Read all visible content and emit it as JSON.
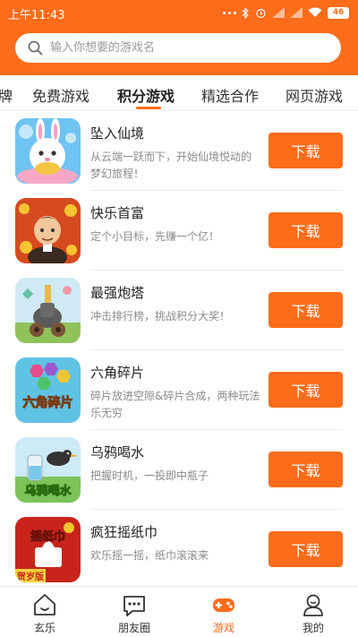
{
  "status_bar": {
    "time": "上午11:43",
    "battery": "46"
  },
  "search": {
    "placeholder": "输入你想要的游戏名"
  },
  "tabs": [
    {
      "label": "牌"
    },
    {
      "label": "免费游戏"
    },
    {
      "label": "积分游戏",
      "active": true
    },
    {
      "label": "精选合作"
    },
    {
      "label": "网页游戏"
    }
  ],
  "games": [
    {
      "title": "坠入仙境",
      "desc": "从云端一跃而下，开始仙境悦动的梦幻旅程！",
      "button": "下载",
      "icon": "bunny-game-icon"
    },
    {
      "title": "快乐首富",
      "desc": "定个小目标，先赚一个亿！",
      "button": "下载",
      "icon": "rich-man-game-icon"
    },
    {
      "title": "最强炮塔",
      "desc": "冲击排行榜，挑战积分大奖！",
      "button": "下载",
      "icon": "cannon-game-icon"
    },
    {
      "title": "六角碎片",
      "desc": "碎片放进空隙&碎片合成，两种玩法乐无穷",
      "button": "下载",
      "icon": "hexagon-game-icon",
      "icon_text": "六角碎片"
    },
    {
      "title": "乌鸦喝水",
      "desc": "把握时机，一投即中瓶子",
      "button": "下载",
      "icon": "crow-game-icon",
      "icon_text": "乌鸦喝水"
    },
    {
      "title": "疯狂摇纸巾",
      "desc": "欢乐摇一摇，纸巾滚滚来",
      "button": "下载",
      "icon": "tissue-game-icon",
      "icon_text": "摇纸巾",
      "icon_badge": "贺岁版"
    }
  ],
  "bottom_nav": [
    {
      "label": "玄乐",
      "icon": "home-icon"
    },
    {
      "label": "朋友圈",
      "icon": "chat-icon"
    },
    {
      "label": "游戏",
      "icon": "gamepad-icon",
      "active": true
    },
    {
      "label": "我的",
      "icon": "profile-icon"
    }
  ],
  "colors": {
    "accent": "#ff6c1a",
    "text": "#222222",
    "muted": "#8a8a8a"
  }
}
